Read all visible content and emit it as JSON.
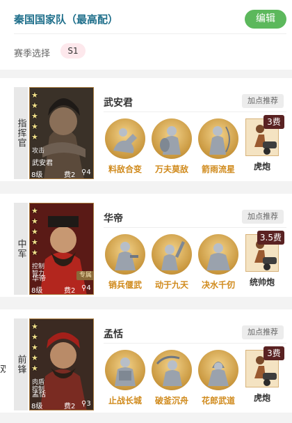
{
  "header": {
    "title": "秦国国家队（最高配）",
    "edit_label": "编辑",
    "season_label": "赛季选择",
    "season_value": "S1"
  },
  "cards": [
    {
      "role": "指挥官",
      "hero_name": "武安君",
      "recommend_label": "加点推荐",
      "portrait": {
        "tags": "攻击",
        "name": "武安君",
        "level": "8级",
        "cost": "费2",
        "range": "4",
        "badge": "",
        "stars": 5
      },
      "skills": [
        {
          "name": "料敌合变",
          "icon": "horseman-icon"
        },
        {
          "name": "万夫莫敌",
          "icon": "shield-warrior-icon"
        },
        {
          "name": "箭雨流星",
          "icon": "archer-icon"
        }
      ],
      "unit": {
        "name": "虎炮",
        "cost": "3费",
        "icon": "cannon-icon"
      }
    },
    {
      "role": "中军",
      "hero_name": "华帝",
      "recommend_label": "加点推荐",
      "portrait": {
        "tags": "控制 智力",
        "name": "华帝",
        "level": "8级",
        "cost": "费2",
        "range": "4",
        "badge": "专属",
        "stars": 5
      },
      "skills": [
        {
          "name": "销兵偃武",
          "icon": "scholar-icon"
        },
        {
          "name": "动于九天",
          "icon": "raised-arm-icon"
        },
        {
          "name": "决水千仞",
          "icon": "warrior-kneel-icon"
        }
      ],
      "unit": {
        "name": "统帅炮",
        "cost": "3.5费",
        "icon": "cannon-icon"
      }
    },
    {
      "role": "前锋",
      "hero_name": "孟恬",
      "recommend_label": "加点推荐",
      "portrait": {
        "tags": "肉盾 控制",
        "name": "孟恬",
        "level": "8级",
        "cost": "费2",
        "range": "3",
        "badge": "",
        "stars": 5
      },
      "skills": [
        {
          "name": "止战长城",
          "icon": "armored-guard-icon"
        },
        {
          "name": "破釜沉舟",
          "icon": "sword-swing-icon"
        },
        {
          "name": "花郎武道",
          "icon": "hooded-fighter-icon"
        }
      ],
      "unit": {
        "name": "虎炮",
        "cost": "3费",
        "icon": "cannon-icon"
      }
    }
  ],
  "side_mark": "双",
  "colors": {
    "title": "#1f6f8b",
    "edit_button": "#5cb85c",
    "skill_name": "#d08a1c",
    "cost_badge": "#5a2222",
    "season_chip": "#fde8ec"
  }
}
